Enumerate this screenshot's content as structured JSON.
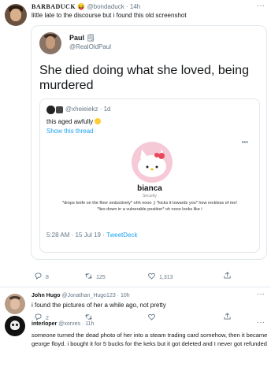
{
  "top_tweet": {
    "display_name": "BARBADUCK",
    "emoji": "😝",
    "handle_time": "@bondaduck · 14h",
    "text": "little late to the discourse but i found this old screenshot"
  },
  "card": {
    "author_name": "Paul",
    "author_handle": "@RealOldPaul",
    "text": "She died doing what she loved, being murdered",
    "quoted": {
      "handle_time": "@xheieiekz · 1d",
      "text": "this aged awfully",
      "show_thread": "Show this thread",
      "image": {
        "name": "bianca",
        "sub": "Security",
        "caption": "*drops knife on the floor seductively* ohh nooo ;) *kicks it towards you* how reckless of me! *lies down in a vulnerable position* oh nooo looks like i"
      }
    },
    "timestamp": "5:28 AM · 15 Jul 19 · ",
    "source": "TweetDeck"
  },
  "actions": {
    "replies": "8",
    "retweets": "125",
    "likes": "1,313"
  },
  "replies": [
    {
      "name": "John Hugo",
      "handle_time": "@Jonathan_Hugo123 · 10h",
      "text": "i found the pictures of her a while ago, not pretty",
      "reply_count": "2"
    },
    {
      "name": "interloper",
      "handle_time": "@xorxes · 11h",
      "text": "someone turned the dead photo of her into a steam trading card somehow, then it became george floyd. i bought it for 5 bucks for the keks but it got deleted and I never got refunded"
    }
  ],
  "colors": {
    "link": "#1da1f2",
    "muted": "#657786",
    "border": "#e1e8ed"
  }
}
